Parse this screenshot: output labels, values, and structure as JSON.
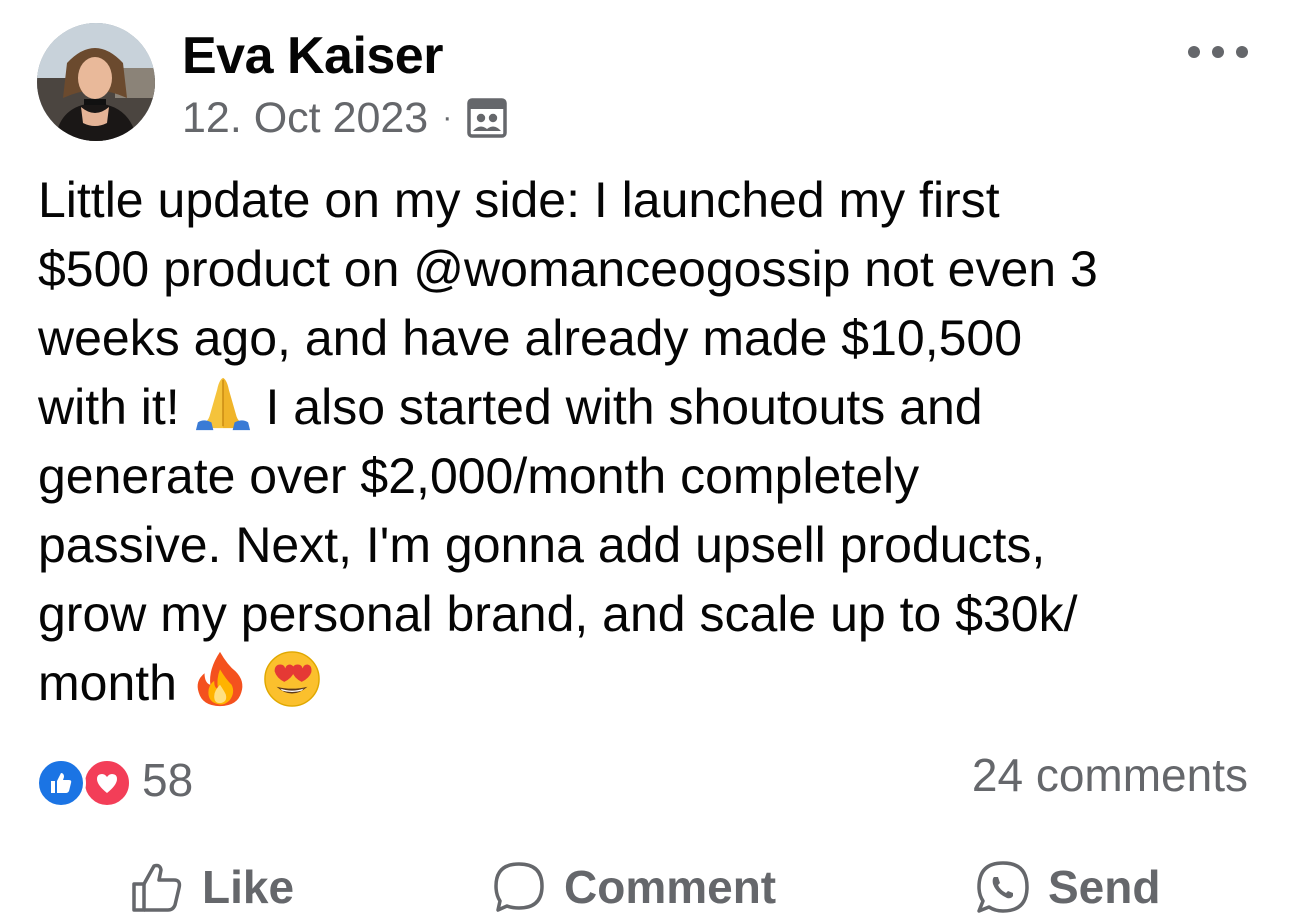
{
  "post": {
    "author_name": "Eva Kaiser",
    "date": "12. Oct 2023",
    "separator": "·",
    "audience_icon": "friends-icon",
    "more_icon": "more-horizontal-icon",
    "text_lines": [
      "Little update on my side: I launched my first",
      "$500 product on @womanceogossip not even 3",
      "weeks ago, and have already made $10,500",
      "with it!",
      "I also started with shoutouts and",
      "generate over $2,000/month completely",
      "passive. Next, I'm gonna add upsell products,",
      "grow my personal brand, and scale up to $30k/",
      "month"
    ],
    "emojis": [
      "folded-hands",
      "fire",
      "smiling-heart-eyes"
    ]
  },
  "stats": {
    "reaction_count": "58",
    "comments": "24 comments",
    "reaction_icons": [
      "like-reaction-icon",
      "love-reaction-icon"
    ]
  },
  "actions": {
    "like_label": "Like",
    "comment_label": "Comment",
    "send_label": "Send"
  },
  "colors": {
    "text": "#050505",
    "secondary": "#65676b",
    "like_blue": "#1b74e4",
    "love_red": "#f33e58"
  }
}
